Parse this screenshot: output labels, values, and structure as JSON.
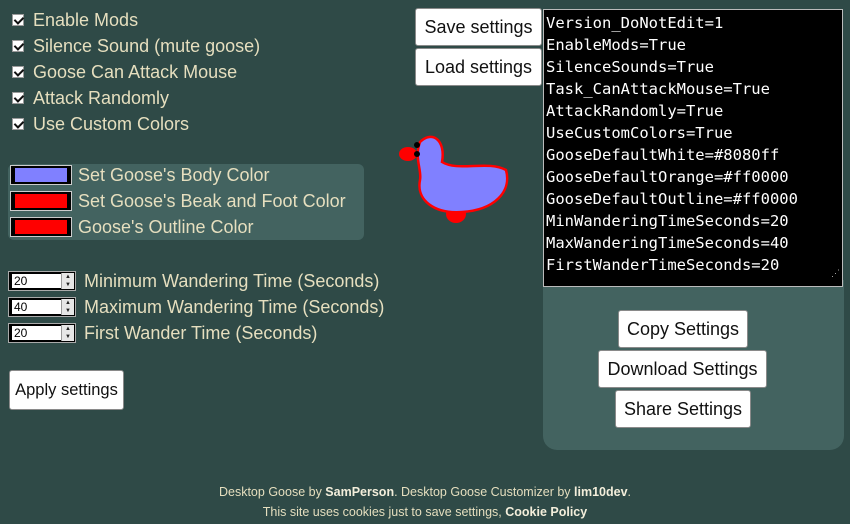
{
  "checkboxes": [
    {
      "label": "Enable Mods",
      "checked": true
    },
    {
      "label": "Silence Sound (mute goose)",
      "checked": true
    },
    {
      "label": "Goose Can Attack Mouse",
      "checked": true
    },
    {
      "label": "Attack Randomly",
      "checked": true
    },
    {
      "label": "Use Custom Colors",
      "checked": true
    }
  ],
  "colors": [
    {
      "label": "Set Goose's Body Color",
      "value": "#8080ff"
    },
    {
      "label": "Set Goose's Beak and Foot Color",
      "value": "#ff0000"
    },
    {
      "label": "Goose's Outline Color",
      "value": "#ff0000"
    }
  ],
  "times": [
    {
      "label": "Minimum Wandering Time (Seconds)",
      "value": "20"
    },
    {
      "label": "Maximum Wandering Time (Seconds)",
      "value": "40"
    },
    {
      "label": "First Wander Time (Seconds)",
      "value": "20"
    }
  ],
  "buttons": {
    "apply": "Apply settings",
    "save": "Save settings",
    "load": "Load settings",
    "copy": "Copy Settings",
    "download": "Download Settings",
    "share": "Share Settings"
  },
  "config_text": "Version_DoNotEdit=1\nEnableMods=True\nSilenceSounds=True\nTask_CanAttackMouse=True\nAttackRandomly=True\nUseCustomColors=True\nGooseDefaultWhite=#8080ff\nGooseDefaultOrange=#ff0000\nGooseDefaultOutline=#ff0000\nMinWanderingTimeSeconds=20\nMaxWanderingTimeSeconds=40\nFirstWanderTimeSeconds=20",
  "footer": {
    "l1_a": "Desktop Goose by ",
    "l1_author": "SamPerson",
    "l1_b": ". Desktop Goose Customizer by ",
    "l1_dev": "lim10dev",
    "l1_c": ".",
    "l2_a": "This site uses cookies just to save settings, ",
    "l2_link": "Cookie Policy"
  },
  "goose_colors": {
    "body": "#8080ff",
    "beak": "#ff0000",
    "outline": "#ff0000",
    "eye": "#000000"
  }
}
